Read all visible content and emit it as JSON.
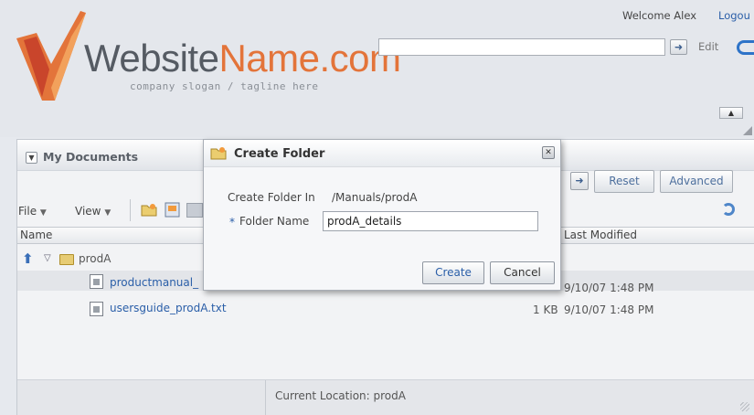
{
  "header": {
    "site_name_part1": "Website",
    "site_name_part2": "Name.com",
    "slogan": "company slogan / tagline here",
    "welcome": "Welcome Alex",
    "logout": "Logou",
    "search_value": "",
    "edit": "Edit"
  },
  "panel": {
    "title": "My Documents",
    "reset_label": "Reset",
    "advanced_label": "Advanced"
  },
  "toolbar": {
    "file_label": "File",
    "view_label": "View"
  },
  "table": {
    "columns": [
      "Name",
      "Last Modified"
    ],
    "folder": "prodA",
    "rows": [
      {
        "name": "productmanual_",
        "size": "",
        "modified": "9/10/07 1:48 PM"
      },
      {
        "name": "usersguide_prodA.txt",
        "size": "1 KB",
        "modified": "9/10/07 1:48 PM"
      }
    ]
  },
  "status": {
    "location": "Current Location: prodA"
  },
  "dialog": {
    "title": "Create Folder",
    "create_in_label": "Create Folder In",
    "create_in_path": "/Manuals/prodA",
    "required_mark": "*",
    "folder_name_label": "Folder Name",
    "folder_name_value": "prodA_details",
    "create_label": "Create",
    "cancel_label": "Cancel"
  },
  "colors": {
    "brand_orange": "#e3743a",
    "brand_gray": "#555b63",
    "link_blue": "#2a5ea8"
  }
}
